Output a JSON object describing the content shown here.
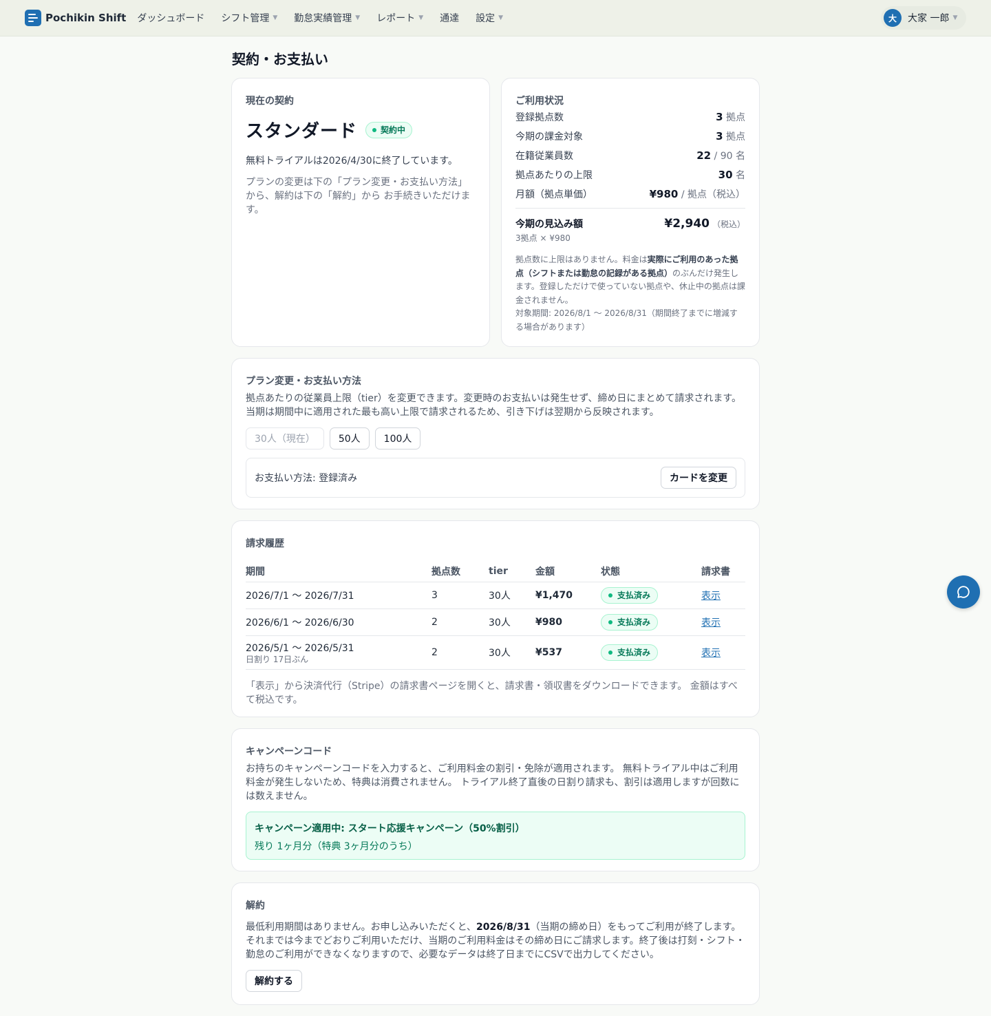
{
  "brand": {
    "name": "Pochikin Shift",
    "logo_icon": "pochikin-logo-icon",
    "color": "#1f6fb2"
  },
  "nav": [
    {
      "label": "ダッシュボード",
      "dropdown": false
    },
    {
      "label": "シフト管理",
      "dropdown": true
    },
    {
      "label": "勤怠実績管理",
      "dropdown": true
    },
    {
      "label": "レポート",
      "dropdown": true
    },
    {
      "label": "通達",
      "dropdown": false
    },
    {
      "label": "設定",
      "dropdown": true
    }
  ],
  "user": {
    "initial": "大",
    "name": "大家 一郎"
  },
  "page": {
    "title": "契約・お支払い"
  },
  "contract": {
    "label": "現在の契約",
    "plan": "スタンダード",
    "status": "契約中",
    "trial": "無料トライアルは2026/4/30に終了しています。",
    "note": "プランの変更は下の「プラン変更・お支払い方法」から、解約は下の「解約」から お手続きいただけます。"
  },
  "usage": {
    "label": "ご利用状況",
    "rows": [
      {
        "label": "登録拠点数",
        "value": "3",
        "unit": " 拠点"
      },
      {
        "label": "今期の課金対象",
        "value": "3",
        "unit": " 拠点"
      },
      {
        "label": "在籍従業員数",
        "value": "22",
        "unit": " / 90 名"
      },
      {
        "label": "拠点あたりの上限",
        "value": "30",
        "unit": " 名"
      },
      {
        "label": "月額（拠点単価）",
        "value": "¥980",
        "unit": " / 拠点（税込）"
      }
    ],
    "estimate_label": "今期の見込み額",
    "estimate_sub": "3拠点 × ¥980",
    "estimate_value": "¥2,940",
    "estimate_unit": "（税込）",
    "note_a": "拠点数に上限はありません。料金は",
    "note_b": "実際にご利用のあった拠点（シフトまたは勤怠の記録がある拠点）",
    "note_c": "のぶんだけ発生します。登録しただけで使っていない拠点や、休止中の拠点は課金されません。",
    "note_period": "対象期間: 2026/8/1 〜 2026/8/31（期間終了までに増減する場合があります）"
  },
  "plan_change": {
    "label": "プラン変更・お支払い方法",
    "desc": "拠点あたりの従業員上限（tier）を変更できます。変更時のお支払いは発生せず、締め日にまとめて請求されます。当期は期間中に適用された最も高い上限で請求されるため、引き下げは翌期から反映されます。",
    "tiers": [
      "30人（現在）",
      "50人",
      "100人"
    ],
    "payment_method": "お支払い方法: 登録済み",
    "change_card": "カードを変更"
  },
  "bills": {
    "label": "請求履歴",
    "headers": [
      "期間",
      "拠点数",
      "tier",
      "金額",
      "状態",
      "請求書"
    ],
    "rows": [
      {
        "period": "2026/7/1 〜 2026/7/31",
        "note": "",
        "sites": "3",
        "tier": "30人",
        "amount": "¥1,470",
        "status": "支払済み",
        "link": "表示"
      },
      {
        "period": "2026/6/1 〜 2026/6/30",
        "note": "",
        "sites": "2",
        "tier": "30人",
        "amount": "¥980",
        "status": "支払済み",
        "link": "表示"
      },
      {
        "period": "2026/5/1 〜 2026/5/31",
        "note": "日割り 17日ぶん",
        "sites": "2",
        "tier": "30人",
        "amount": "¥537",
        "status": "支払済み",
        "link": "表示"
      }
    ],
    "footer": "「表示」から決済代行（Stripe）の請求書ページを開くと、請求書・領収書をダウンロードできます。 金額はすべて税込です。"
  },
  "campaign": {
    "label": "キャンペーンコード",
    "desc": "お持ちのキャンペーンコードを入力すると、ご利用料金の割引・免除が適用されます。 無料トライアル中はご利用料金が発生しないため、特典は消費されません。 トライアル終了直後の日割り請求も、割引は適用しますが回数には数えません。",
    "active_title": "キャンペーン適用中: スタート応援キャンペーン（50%割引）",
    "active_sub": "残り 1ヶ月分（特典 3ヶ月分のうち）"
  },
  "cancel": {
    "label": "解約",
    "text_a": "最低利用期間はありません。お申し込みいただくと、",
    "date": "2026/8/31",
    "text_b": "（当期の締め日）をもってご利用が終了します。それまでは今までどおりご利用いただけ、当期のご利用料金はその締め日にご請求します。終了後は打刻・シフト・勤怠のご利用ができなくなりますので、必要なデータは終了日までにCSVで出力してください。",
    "button": "解約する"
  },
  "chat": {
    "icon": "chat-bubble-icon"
  }
}
